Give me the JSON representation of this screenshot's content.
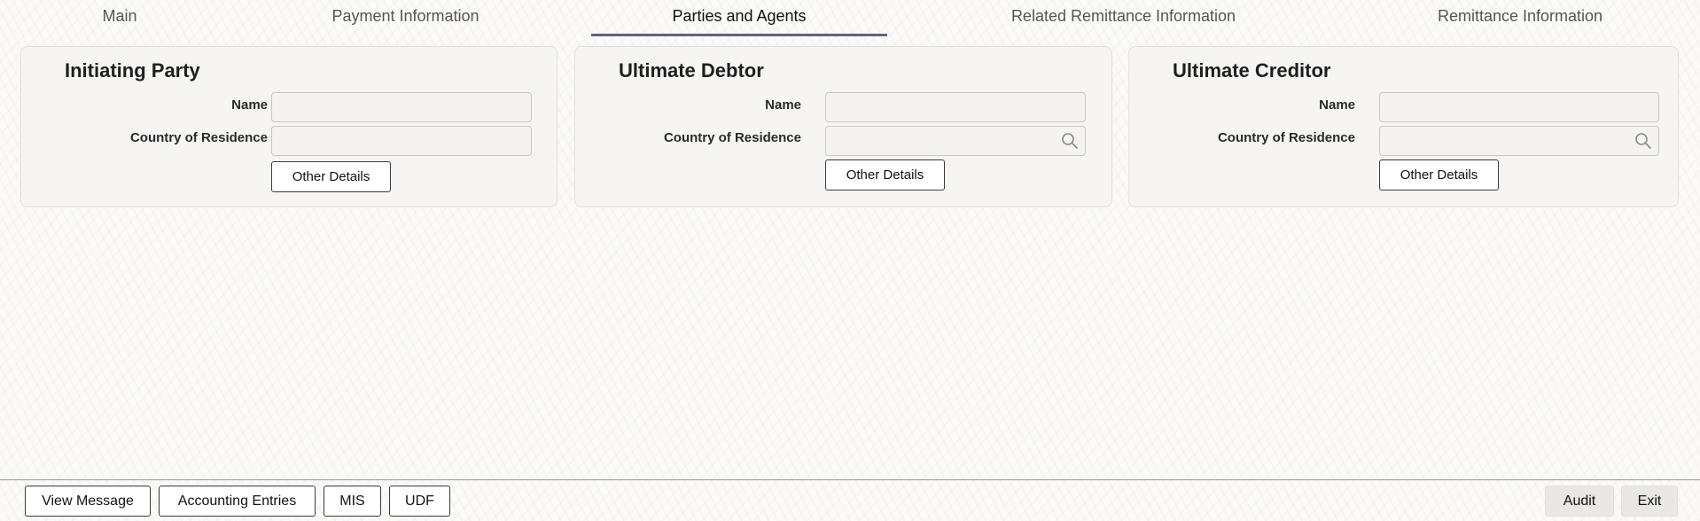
{
  "tabs": [
    {
      "label": "Main"
    },
    {
      "label": "Payment Information"
    },
    {
      "label": "Parties and Agents"
    },
    {
      "label": "Related Remittance Information"
    },
    {
      "label": "Remittance Information"
    }
  ],
  "active_tab": "Parties and Agents",
  "panels": [
    {
      "title": "Initiating Party",
      "name_label": "Name",
      "name_value": "",
      "country_label": "Country of Residence",
      "country_value": "",
      "has_search": false,
      "other_details_label": "Other Details"
    },
    {
      "title": "Ultimate Debtor",
      "name_label": "Name",
      "name_value": "",
      "country_label": "Country of Residence",
      "country_value": "",
      "has_search": true,
      "other_details_label": "Other Details"
    },
    {
      "title": "Ultimate Creditor",
      "name_label": "Name",
      "name_value": "",
      "country_label": "Country of Residence",
      "country_value": "",
      "has_search": true,
      "other_details_label": "Other Details"
    }
  ],
  "footer": {
    "view_message": "View Message",
    "accounting_entries": "Accounting Entries",
    "mis": "MIS",
    "udf": "UDF",
    "audit": "Audit",
    "exit": "Exit"
  },
  "colors": {
    "active_tab_underline": "#5d6584",
    "panel_background": "#f6f5f3"
  }
}
